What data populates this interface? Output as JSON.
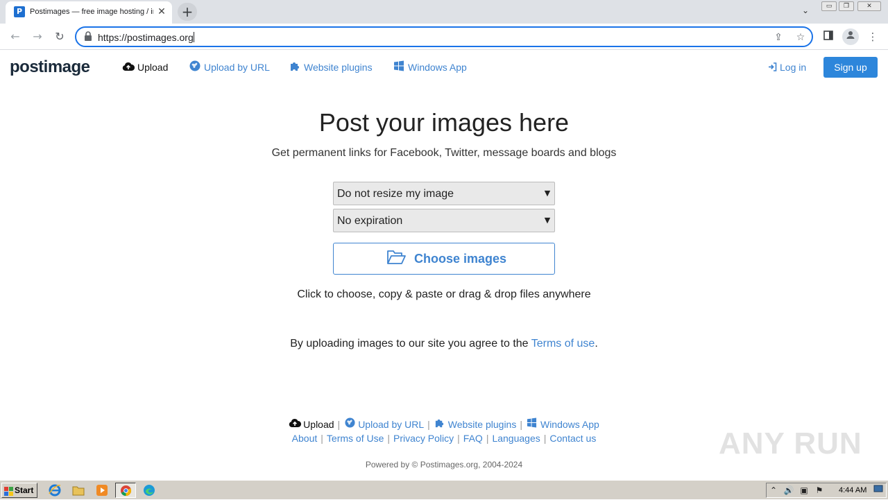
{
  "browser": {
    "tab_title": "Postimages — free image hosting / image upload",
    "tab_favicon": "P",
    "url": "https://postimages.org",
    "window_controls": {
      "minimize": "▭",
      "restore": "❐",
      "close": "✕"
    },
    "icons": {
      "back": "arrow-left-icon",
      "forward": "arrow-right-icon",
      "reload": "reload-icon",
      "lock": "lock-icon",
      "share": "share-icon",
      "star": "star-icon",
      "sidepanel": "side-panel-icon",
      "profile": "profile-icon",
      "menu": "kebab-menu-icon"
    }
  },
  "site": {
    "logo_text": "postimage",
    "nav": {
      "upload": "Upload",
      "upload_by_url": "Upload by URL",
      "website_plugins": "Website plugins",
      "windows_app": "Windows App",
      "log_in": "Log in",
      "sign_up": "Sign up"
    },
    "main": {
      "headline": "Post your images here",
      "subline": "Get permanent links for Facebook, Twitter, message boards and blogs",
      "resize_select": "Do not resize my image",
      "expiration_select": "No expiration",
      "choose_button": "Choose images",
      "hint": "Click to choose, copy & paste or drag & drop files anywhere",
      "terms_prefix": "By uploading images to our site you agree to the ",
      "terms_link": "Terms of use",
      "terms_suffix": "."
    },
    "footer": {
      "row1": {
        "upload": "Upload",
        "upload_by_url": "Upload by URL",
        "website_plugins": "Website plugins",
        "windows_app": "Windows App"
      },
      "row2": [
        "About",
        "Terms of Use",
        "Privacy Policy",
        "FAQ",
        "Languages",
        "Contact us"
      ],
      "separator": "|",
      "powered": "Powered by © Postimages.org, 2004-2024"
    }
  },
  "watermark": "ANY RUN",
  "taskbar": {
    "start_label": "Start",
    "clock": "4:44 AM"
  },
  "colors": {
    "link_blue": "#3f84d0",
    "button_blue": "#2d86db",
    "omnibox_focus": "#1a73e8"
  }
}
